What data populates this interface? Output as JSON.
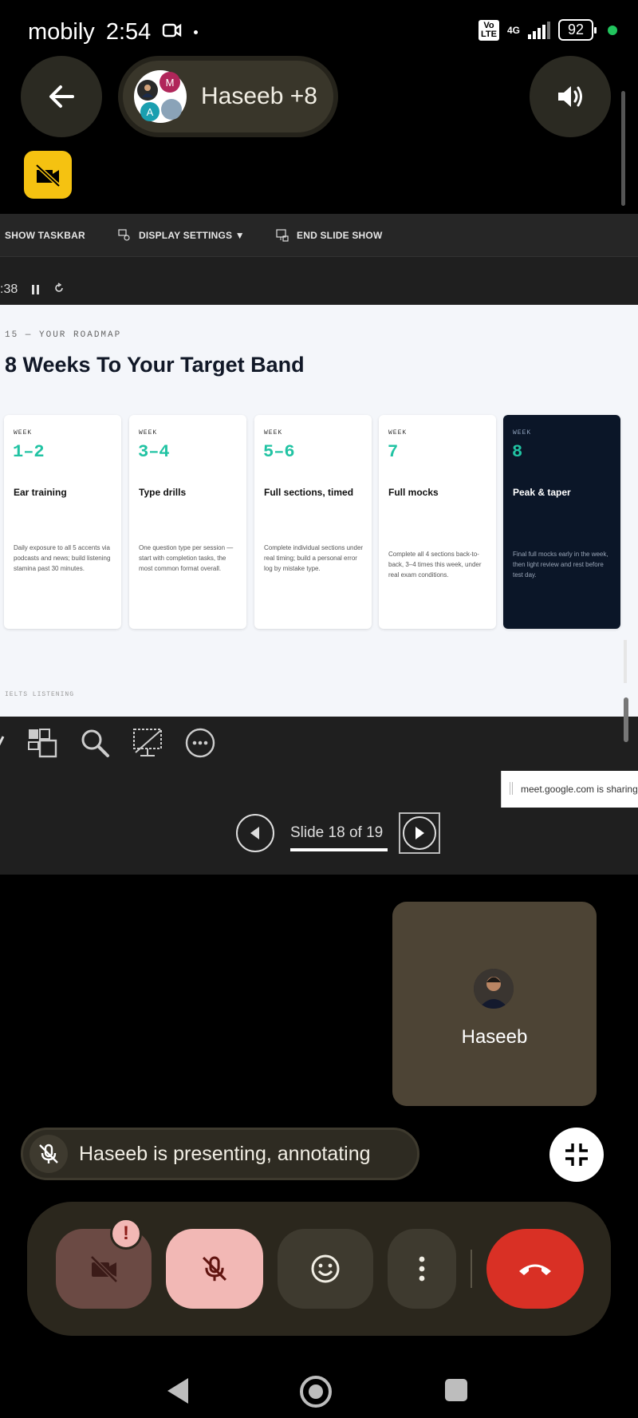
{
  "status_bar": {
    "carrier": "mobily",
    "time": "2:54",
    "volte": "Vo\nLTE",
    "network": "4G",
    "battery": "92"
  },
  "header": {
    "title": "Haseeb +8",
    "avatar_letters": [
      "M",
      "A"
    ]
  },
  "share": {
    "toolbar": {
      "show_taskbar": "SHOW TASKBAR",
      "display_settings": "DISPLAY SETTINGS ▼",
      "end_show": "END SLIDE SHOW"
    },
    "timer": ":38",
    "slide": {
      "label": "15 — YOUR ROADMAP",
      "title": "8 Weeks To Your Target Band",
      "footer": "IELTS LISTENING",
      "cards": [
        {
          "week_label": "WEEK",
          "num": "1–2",
          "name": "Ear training",
          "desc": "Daily exposure to all 5 accents via podcasts and news; build listening stamina past 30 minutes."
        },
        {
          "week_label": "WEEK",
          "num": "3–4",
          "name": "Type drills",
          "desc": "One question type per session — start with completion tasks, the most common format overall."
        },
        {
          "week_label": "WEEK",
          "num": "5–6",
          "name": "Full sections, timed",
          "desc": "Complete individual sections under real timing; build a personal error log by mistake type."
        },
        {
          "week_label": "WEEK",
          "num": "7",
          "name": "Full mocks",
          "desc": "Complete all 4 sections back-to-back, 3–4 times this week, under real exam conditions."
        },
        {
          "week_label": "WEEK",
          "num": "8",
          "name": "Peak & taper",
          "desc": "Final full mocks early in the week, then light review and rest before test day."
        }
      ]
    },
    "notice": "meet.google.com is sharing y",
    "nav": {
      "text": "Slide 18 of 19"
    }
  },
  "self_tile": {
    "name": "Haseeb"
  },
  "presenting": {
    "text": "Haseeb is presenting, annotating"
  },
  "controls": {
    "alert_badge": "!"
  },
  "colors": {
    "accent_teal": "#21c3a3",
    "end_call": "#d93025",
    "mic_off_bg": "#f2b8b5",
    "camera_badge_bg": "#f5c211"
  }
}
